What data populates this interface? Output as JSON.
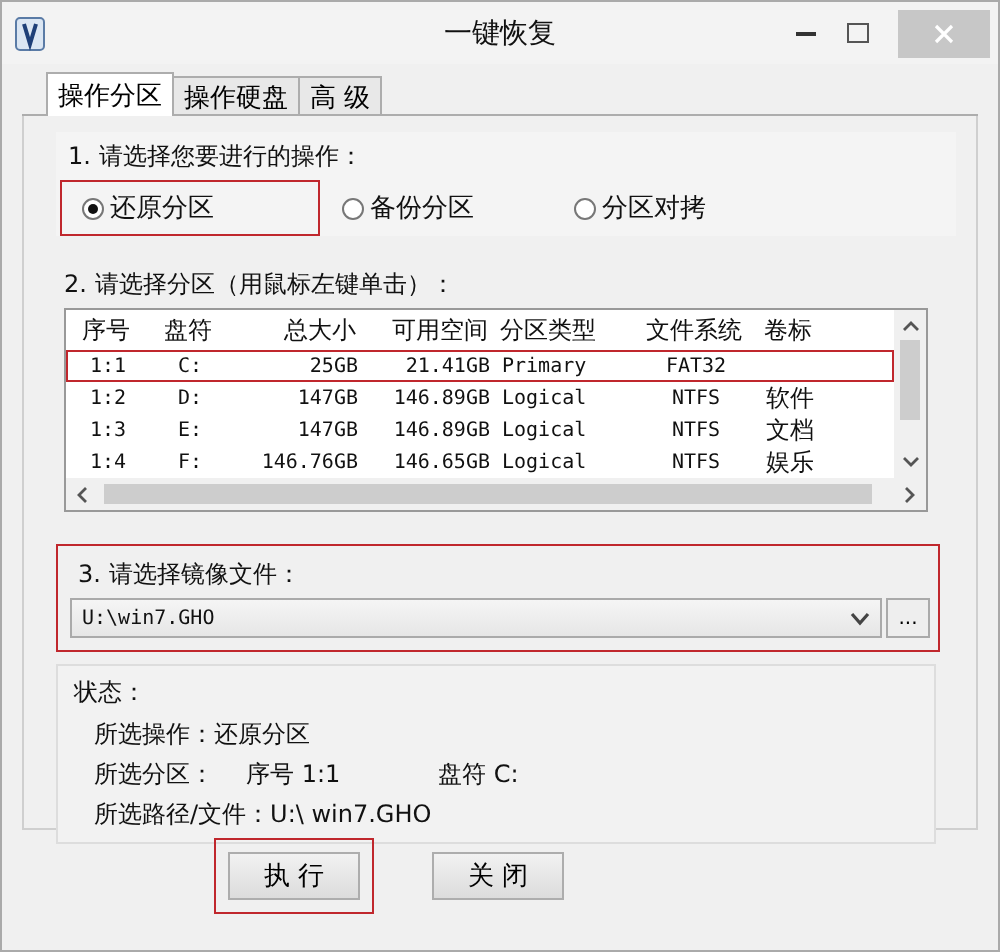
{
  "window": {
    "title": "一键恢复"
  },
  "tabs": [
    {
      "label": "操作分区",
      "selected": true
    },
    {
      "label": "操作硬盘",
      "selected": false
    },
    {
      "label": "高 级",
      "selected": false
    }
  ],
  "operation": {
    "label": "1. 请选择您要进行的操作：",
    "options": [
      {
        "label": "还原分区",
        "selected": true,
        "highlighted": true
      },
      {
        "label": "备份分区",
        "selected": false,
        "highlighted": false
      },
      {
        "label": "分区对拷",
        "selected": false,
        "highlighted": false
      }
    ]
  },
  "partitions": {
    "label": "2. 请选择分区（用鼠标左键单击）：",
    "columns": [
      "序号",
      "盘符",
      "总大小",
      "可用空间",
      "分区类型",
      "文件系统",
      "卷标"
    ],
    "rows": [
      {
        "cells": [
          "1:1",
          "C:",
          "25GB",
          "21.41GB",
          "Primary",
          "FAT32",
          ""
        ],
        "selected": true
      },
      {
        "cells": [
          "1:2",
          "D:",
          "147GB",
          "146.89GB",
          "Logical",
          "NTFS",
          "软件"
        ],
        "selected": false
      },
      {
        "cells": [
          "1:3",
          "E:",
          "147GB",
          "146.89GB",
          "Logical",
          "NTFS",
          "文档"
        ],
        "selected": false
      },
      {
        "cells": [
          "1:4",
          "F:",
          "146.76GB",
          "146.65GB",
          "Logical",
          "NTFS",
          "娱乐"
        ],
        "selected": false
      }
    ]
  },
  "image_file": {
    "label": "3. 请选择镜像文件：",
    "value": "U:\\win7.GHO",
    "browse_button": "...",
    "highlighted": true
  },
  "status": {
    "title": "状态：",
    "lines": [
      {
        "parts": [
          "所选操作：还原分区"
        ]
      },
      {
        "parts": [
          "所选分区：",
          "序号 1:1",
          "盘符 C:"
        ]
      },
      {
        "parts": [
          "所选路径/文件：U:\\ win7.GHO"
        ]
      }
    ]
  },
  "buttons": [
    {
      "label": "执 行",
      "highlighted": true
    },
    {
      "label": "关 闭",
      "highlighted": false
    }
  ]
}
